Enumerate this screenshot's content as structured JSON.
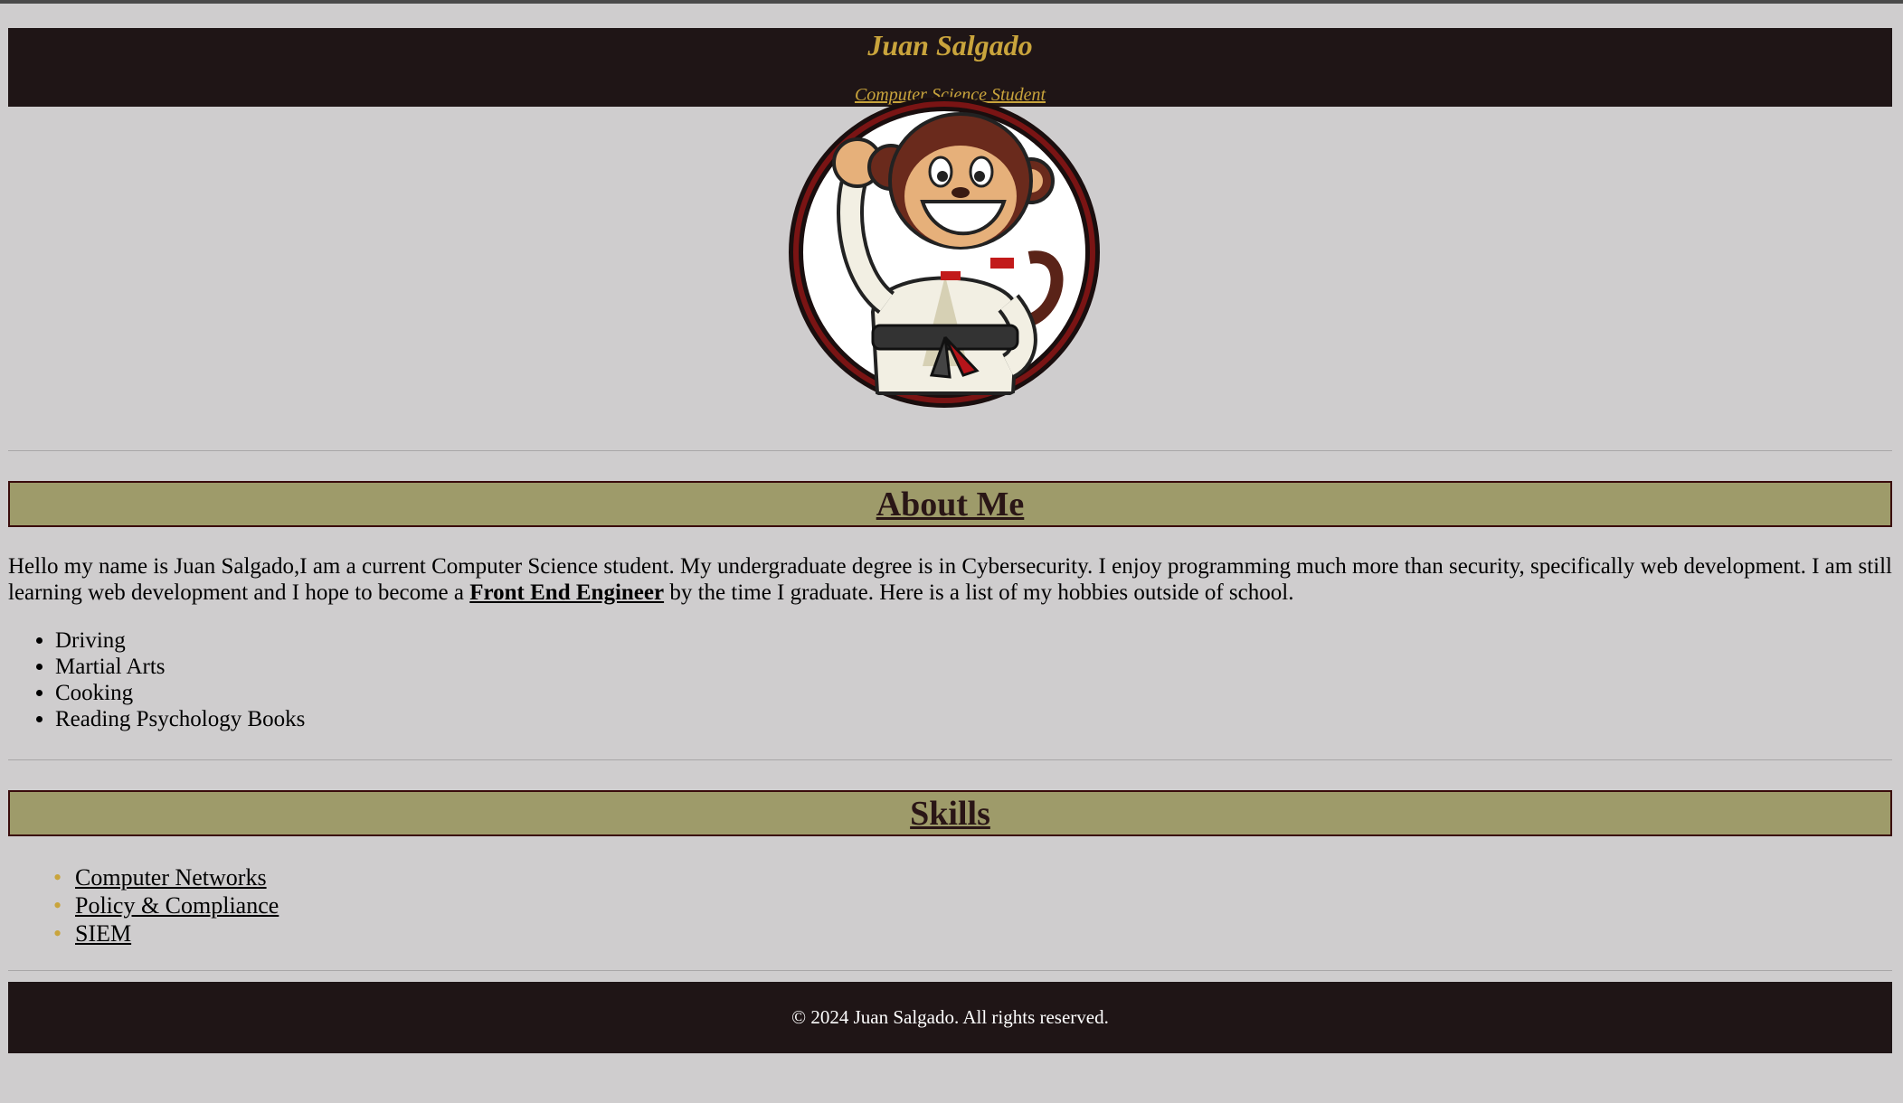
{
  "header": {
    "name": "Juan Salgado",
    "role": "Computer Science Student"
  },
  "avatar": {
    "alt": "Karate monkey mascot"
  },
  "about": {
    "heading": "About Me",
    "text_before": "Hello my name is Juan Salgado,I am a current Computer Science student. My undergraduate degree is in Cybersecurity. I enjoy programming much more than security, specifically web development. I am still learning web development and I hope to become a ",
    "highlight": "Front End Engineer",
    "text_after": " by the time I graduate. Here is a list of my hobbies outside of school.",
    "hobbies": [
      "Driving",
      "Martial Arts",
      "Cooking",
      "Reading Psychology Books"
    ]
  },
  "skills": {
    "heading": "Skills",
    "items": [
      "Computer Networks",
      "Policy & Compliance",
      "SIEM"
    ]
  },
  "footer": {
    "text": "© 2024 Juan Salgado. All rights reserved."
  },
  "colors": {
    "background": "#cfcdce",
    "header_bg": "#1f1516",
    "accent_gold": "#c9a43c",
    "section_bg": "#9e9b6a",
    "section_border": "#3a0c0c"
  }
}
